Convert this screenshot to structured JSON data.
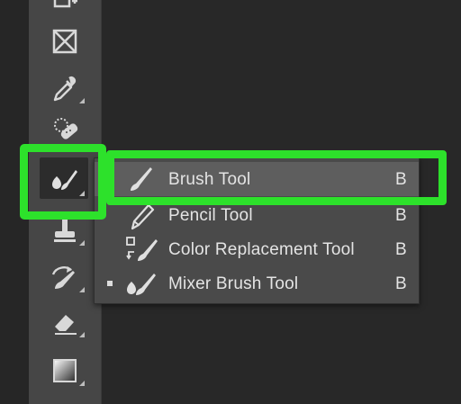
{
  "toolbar": {
    "tools": [
      {
        "name": "artboard-tool",
        "icon": "artboard-icon"
      },
      {
        "name": "frame-tool",
        "icon": "frame-icon"
      },
      {
        "name": "eyedropper-tool",
        "icon": "eyedropper-icon"
      },
      {
        "name": "healing-brush-tool",
        "icon": "bandage-icon"
      },
      {
        "name": "brush-tool",
        "icon": "brush-icon",
        "active": true
      },
      {
        "name": "clone-stamp-tool",
        "icon": "stamp-icon"
      },
      {
        "name": "history-brush-tool",
        "icon": "history-brush-icon"
      },
      {
        "name": "eraser-tool",
        "icon": "eraser-icon"
      },
      {
        "name": "gradient-tool",
        "icon": "gradient-icon"
      }
    ]
  },
  "flyout": {
    "items": [
      {
        "label": "Brush Tool",
        "shortcut": "B",
        "icon": "brush-icon",
        "selected": true
      },
      {
        "label": "Pencil Tool",
        "shortcut": "B",
        "icon": "pencil-icon"
      },
      {
        "label": "Color Replacement Tool",
        "shortcut": "B",
        "icon": "color-replacement-icon"
      },
      {
        "label": "Mixer Brush Tool",
        "shortcut": "B",
        "icon": "mixer-brush-icon",
        "current": true
      }
    ]
  },
  "colors": {
    "highlight": "#2de12b",
    "toolbar_bg": "#464646",
    "menu_bg": "#4a4a4a",
    "menu_selected": "#5e5e5e",
    "text": "#e4e4e4"
  }
}
